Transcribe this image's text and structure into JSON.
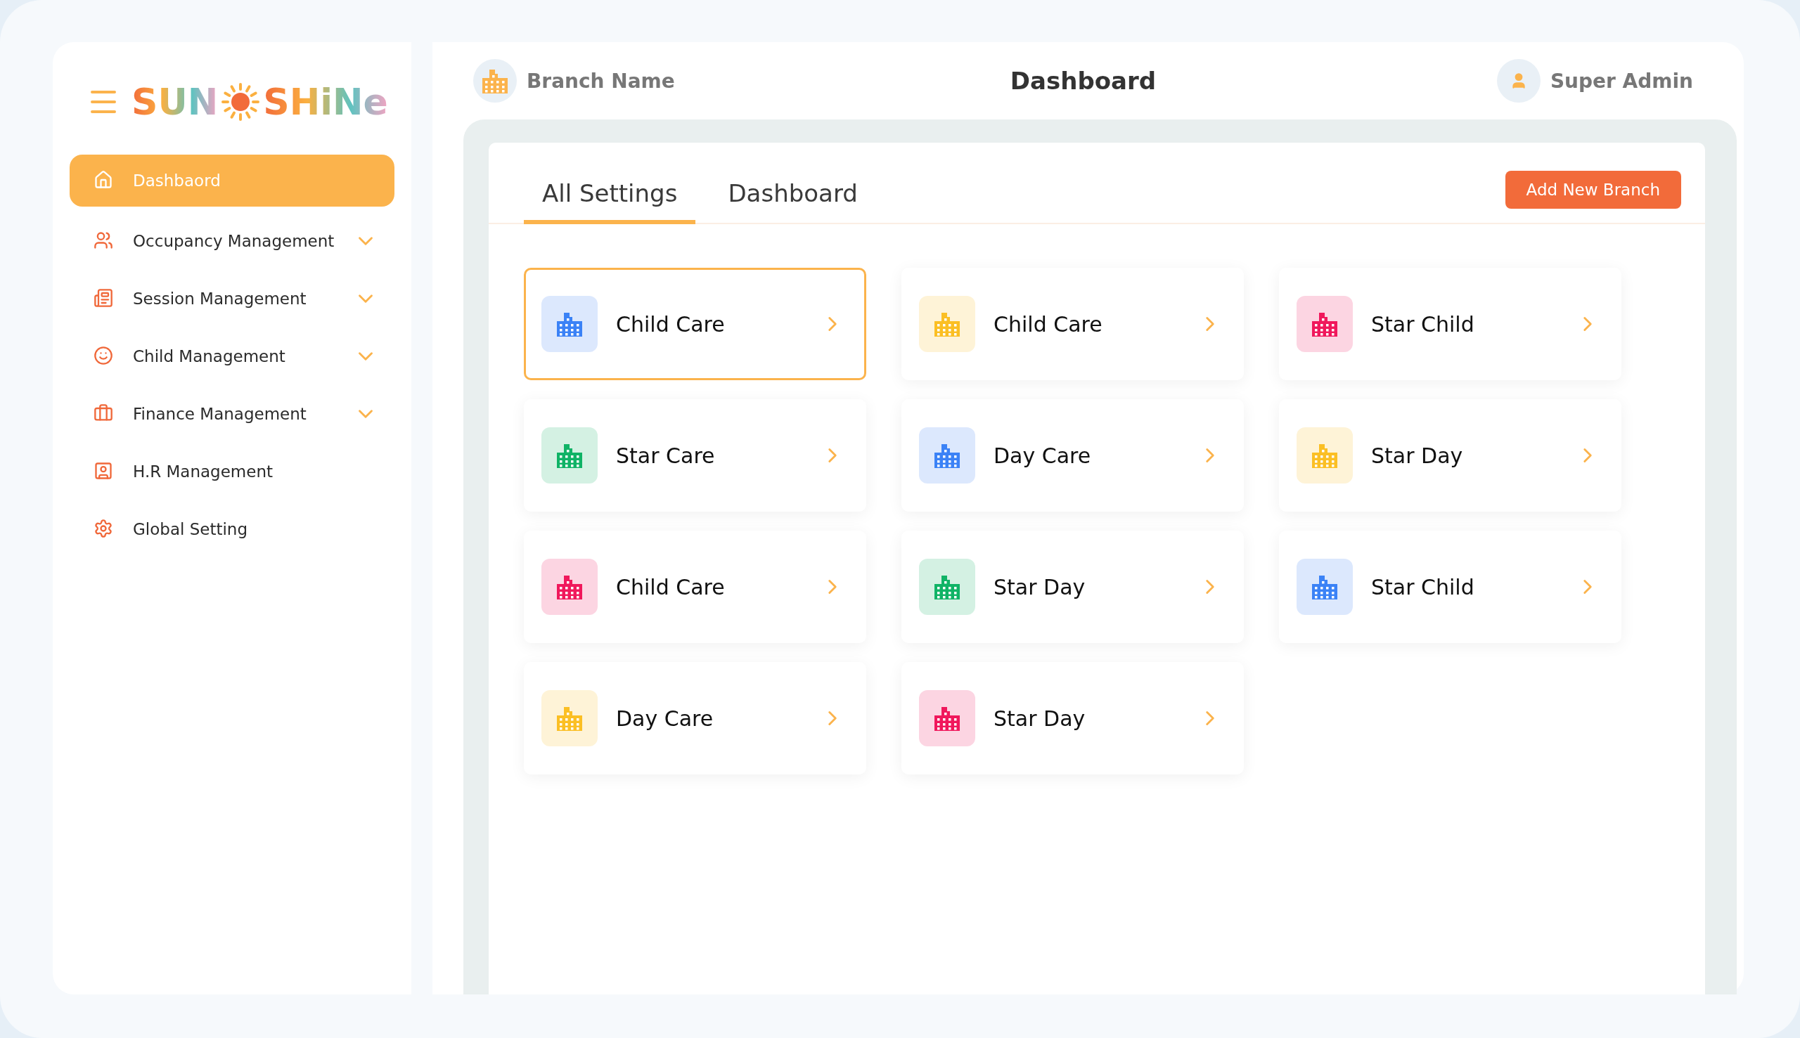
{
  "logo": {
    "parts": [
      "SUN",
      "SHiNe"
    ]
  },
  "sidebar": {
    "items": [
      {
        "label": "Dashbaord",
        "selected": true,
        "has_submenu": false
      },
      {
        "label": "Occupancy Management",
        "selected": false,
        "has_submenu": true
      },
      {
        "label": "Session Management",
        "selected": false,
        "has_submenu": true
      },
      {
        "label": "Child Management",
        "selected": false,
        "has_submenu": true
      },
      {
        "label": "Finance Management",
        "selected": false,
        "has_submenu": true
      },
      {
        "label": "H.R Management",
        "selected": false,
        "has_submenu": false
      },
      {
        "label": "Global Setting",
        "selected": false,
        "has_submenu": false
      }
    ]
  },
  "header": {
    "branch": "Branch Name",
    "title": "Dashboard",
    "user": "Super Admin"
  },
  "tabs": [
    {
      "label": "All Settings",
      "selected": true
    },
    {
      "label": "Dashboard",
      "selected": false
    }
  ],
  "add_button": "Add New Branch",
  "branches": [
    {
      "name": "Child Care",
      "color": "#3b82f6",
      "selected": true
    },
    {
      "name": "Child Care",
      "color": "#fbbf24",
      "selected": false
    },
    {
      "name": "Star Child",
      "color": "#f0185c",
      "selected": false
    },
    {
      "name": "Star Care",
      "color": "#10b366",
      "selected": false
    },
    {
      "name": "Day Care",
      "color": "#3b82f6",
      "selected": false
    },
    {
      "name": "Star Day",
      "color": "#fbbf24",
      "selected": false
    },
    {
      "name": "Child Care",
      "color": "#f0185c",
      "selected": false
    },
    {
      "name": "Star Day",
      "color": "#10b366",
      "selected": false
    },
    {
      "name": "Star Child",
      "color": "#3b82f6",
      "selected": false
    },
    {
      "name": "Day Care",
      "color": "#fbbf24",
      "selected": false
    },
    {
      "name": "Star Day",
      "color": "#f0185c",
      "selected": false
    }
  ]
}
